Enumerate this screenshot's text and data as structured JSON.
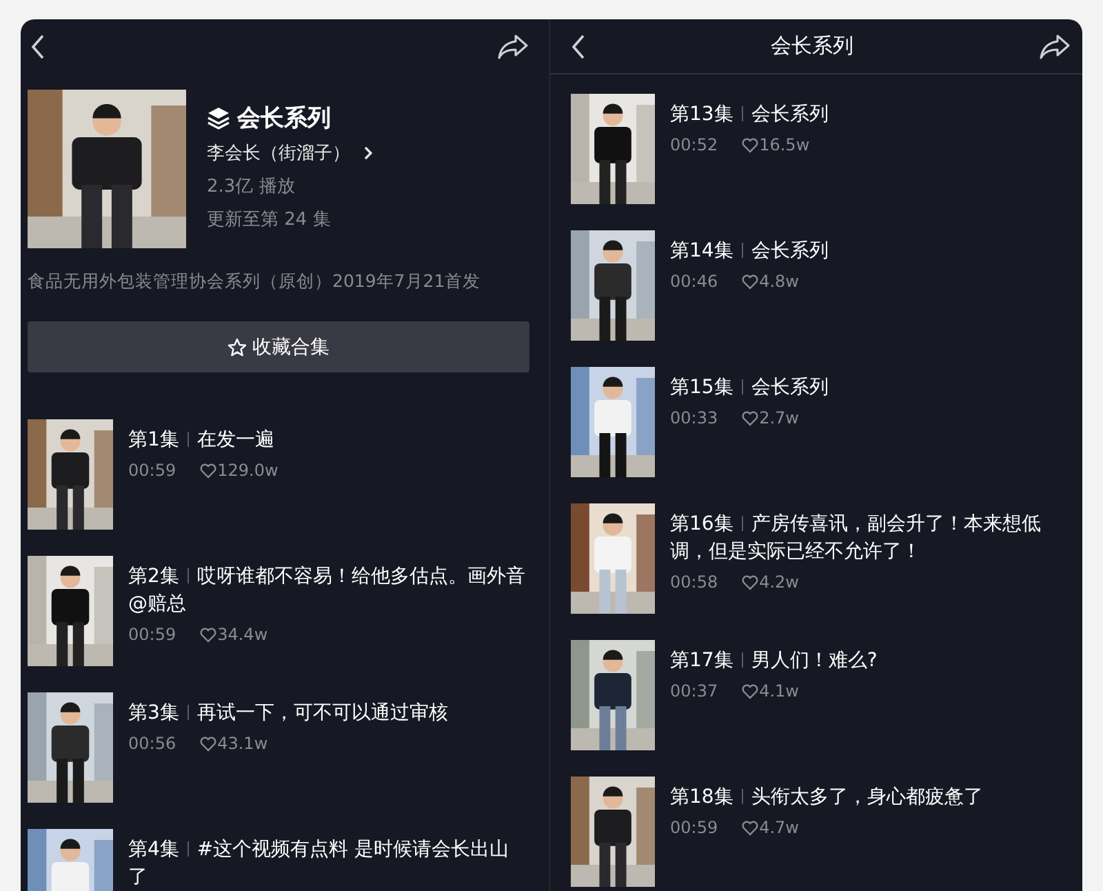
{
  "left_screen": {
    "collection": {
      "title": "会长系列",
      "author": "李会长（街溜子）",
      "plays": "2.3亿 播放",
      "update": "更新至第 24 集",
      "description": "食品无用外包装管理协会系列（原创）2019年7月21首发",
      "favorite_button": "收藏合集"
    },
    "episodes": [
      {
        "episode": "第1集",
        "title": "在发一遍",
        "duration": "00:59",
        "likes": "129.0w"
      },
      {
        "episode": "第2集",
        "title": "哎呀谁都不容易！给他多估点。画外音 @赔总",
        "duration": "00:59",
        "likes": "34.4w"
      },
      {
        "episode": "第3集",
        "title": "再试一下，可不可以通过审核",
        "duration": "00:56",
        "likes": "43.1w"
      },
      {
        "episode": "第4集",
        "title": "#这个视频有点料 是时候请会长出山了"
      }
    ]
  },
  "right_screen": {
    "header": {
      "title": "会长系列"
    },
    "episodes": [
      {
        "episode": "第13集",
        "title": "会长系列",
        "duration": "00:52",
        "likes": "16.5w"
      },
      {
        "episode": "第14集",
        "title": "会长系列",
        "duration": "00:46",
        "likes": "4.8w"
      },
      {
        "episode": "第15集",
        "title": "会长系列",
        "duration": "00:33",
        "likes": "2.7w"
      },
      {
        "episode": "第16集",
        "title": "产房传喜讯，副会升了！本来想低调，但是实际已经不允许了！",
        "duration": "00:58",
        "likes": "4.2w"
      },
      {
        "episode": "第17集",
        "title": "男人们！难么?",
        "duration": "00:37",
        "likes": "4.1w"
      },
      {
        "episode": "第18集",
        "title": "头衔太多了，身心都疲惫了",
        "duration": "00:59",
        "likes": "4.7w"
      }
    ]
  }
}
